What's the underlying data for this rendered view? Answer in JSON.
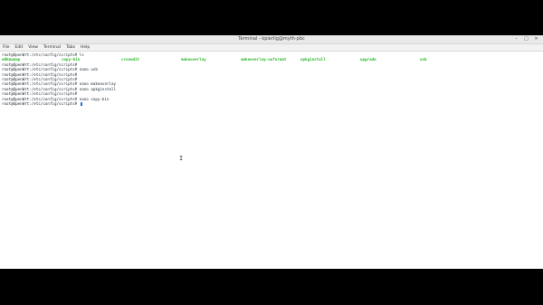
{
  "window": {
    "title": "Terminal - kpierlig@myth-pbc",
    "controls": [
      "–",
      "□",
      "✕"
    ]
  },
  "menu": [
    "File",
    "Edit",
    "View",
    "Terminal",
    "Tabs",
    "Help"
  ],
  "terminal": {
    "lines": [
      {
        "prompt": "root@OpenWrt:/etc/config/scripts#",
        "cmd": " ls"
      },
      {
        "ls": [
          "e0kmumap",
          "copy-bin",
          "cronedit",
          "makeoverlay",
          "makeoverlay-noformat",
          "opkginstall",
          "upgrade",
          "usb"
        ]
      },
      {
        "prompt": "root@OpenWrt:/etc/config/scripts#",
        "cmd": ""
      },
      {
        "prompt": "root@OpenWrt:/etc/config/scripts#",
        "cmd": " nano usb"
      },
      {
        "prompt": "root@OpenWrt:/etc/config/scripts#",
        "cmd": ""
      },
      {
        "prompt": "root@OpenWrt:/etc/config/scripts#",
        "cmd": ""
      },
      {
        "prompt": "root@OpenWrt:/etc/config/scripts#",
        "cmd": " nano makeoverlay"
      },
      {
        "prompt": "root@OpenWrt:/etc/config/scripts#",
        "cmd": " nano opkginstall"
      },
      {
        "prompt": "root@OpenWrt:/etc/config/scripts#",
        "cmd": ""
      },
      {
        "prompt": "root@OpenWrt:/etc/config/scripts#",
        "cmd": " nano copy-bin"
      },
      {
        "prompt": "root@OpenWrt:/etc/config/scripts#",
        "cmd": " ",
        "cursor": true
      }
    ],
    "colors": {
      "ls_green": "#2eb82e",
      "cursor": "#2b6cd4",
      "text": "#1f2a33"
    }
  },
  "mouse_pointer": "I"
}
